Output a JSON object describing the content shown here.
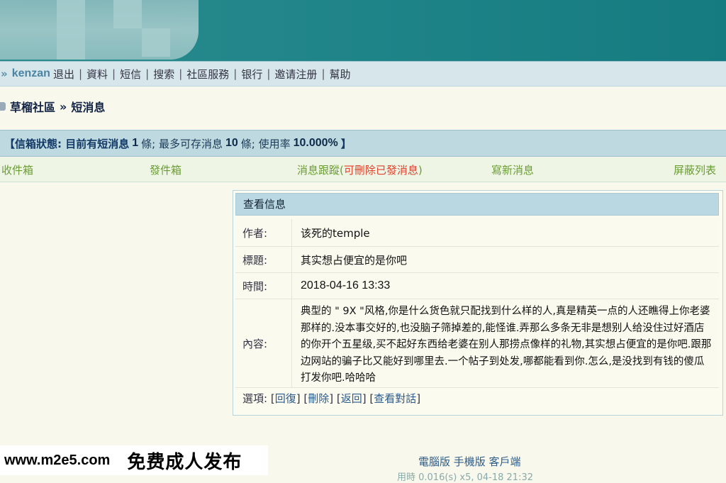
{
  "nav": {
    "username": "kenzan",
    "items": [
      "退出",
      "資料",
      "短信",
      "搜索",
      "社區服務",
      "银行",
      "邀请注册",
      "幫助"
    ]
  },
  "breadcrumb": {
    "forum": "草榴社區",
    "separator": "»",
    "page": "短消息"
  },
  "mailbox": {
    "prefix": "【信箱狀態: 目前有短消息",
    "count": "1",
    "mid1": "條; 最多可存消息",
    "max": "10",
    "mid2": "條; 使用率",
    "usage": "10.000%",
    "suffix": "】"
  },
  "tabs": {
    "inbox": "收件箱",
    "outbox": "發件箱",
    "track": "消息跟蹤",
    "track_paren_open": "(",
    "track_note": "可刪除已發消息",
    "track_paren_close": ")",
    "compose": "寫新消息",
    "blocklist": "屏蔽列表"
  },
  "message": {
    "panel_title": "查看信息",
    "author_label": "作者:",
    "author": "该死的temple",
    "title_label": "標題:",
    "title": "其实想占便宜的是你吧",
    "time_label": "時間:",
    "time": "2018-04-16 13:33",
    "content_label": "內容:",
    "content": "典型的 \" 9X \"风格,你是什么货色就只配找到什么样的人,真是精英一点的人还瞧得上你老婆那样的.没本事交好的,也没脑子筛掉差的,能怪谁.弄那么多条无非是想别人给没住过好酒店的你开个五星级,买不起好东西给老婆在别人那捞点像样的礼物,其实想占便宜的是你吧.跟那边网站的骗子比又能好到哪里去.一个帖子到处发,哪都能看到你.怎么,是没找到有钱的傻瓜打发你吧.哈哈哈",
    "options_label": "選項:",
    "options": [
      "回復",
      "刪除",
      "返回",
      "查看對話"
    ]
  },
  "footer": {
    "links": "電腦版 手機版 客戶端",
    "partial": "用時 0.016(s) x5, 04-18 21:32"
  },
  "watermark": {
    "url": "www.m2e5.com",
    "text": "免费成人发布"
  },
  "colors": {
    "header": "#1f8488",
    "nav_bg": "#d6e6ea",
    "tab_text": "#6b9d35",
    "tab_red": "#e0422c",
    "page_bg": "#f8f8ec"
  }
}
